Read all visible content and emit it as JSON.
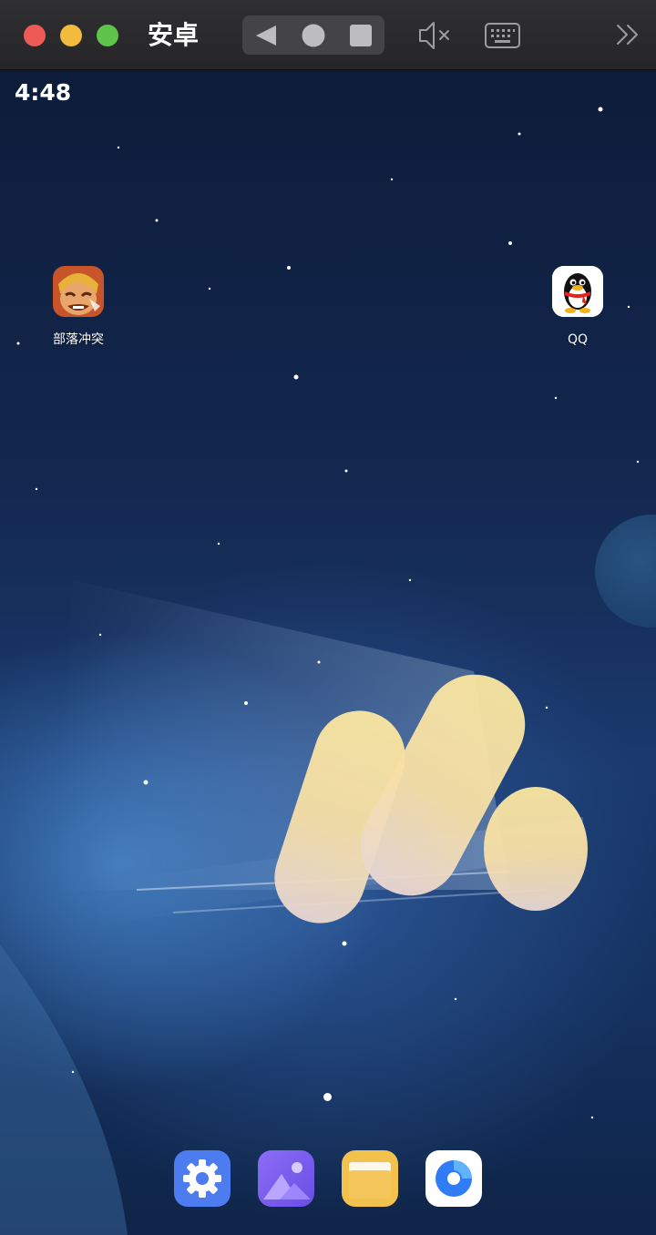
{
  "window": {
    "title": "安卓",
    "controls": [
      "close-light",
      "minimize-light",
      "zoom-light"
    ],
    "nav_buttons": [
      "back-icon",
      "home-icon",
      "recents-icon"
    ],
    "toolbar_icons": [
      "mute-icon",
      "keyboard-icon",
      "more-icon"
    ]
  },
  "status_bar": {
    "time": "4:48"
  },
  "home_apps": [
    {
      "label": "部落冲突",
      "icon": "clash-of-clans-icon"
    },
    {
      "label": "QQ",
      "icon": "qq-penguin-icon"
    }
  ],
  "page_indicator": {
    "pages": 1,
    "current": 1
  },
  "dock": [
    {
      "icon": "settings-icon",
      "color": "#4d7cf0"
    },
    {
      "icon": "gallery-icon",
      "color": "#7a5cf0"
    },
    {
      "icon": "files-icon",
      "color": "#f2c14e"
    },
    {
      "icon": "browser-icon",
      "color": "#2f7cf6"
    }
  ],
  "colors": {
    "titlebar": "#2a2a2c",
    "close": "#ee5b56",
    "minimize": "#f2bb3d",
    "zoom": "#5ec44a"
  }
}
